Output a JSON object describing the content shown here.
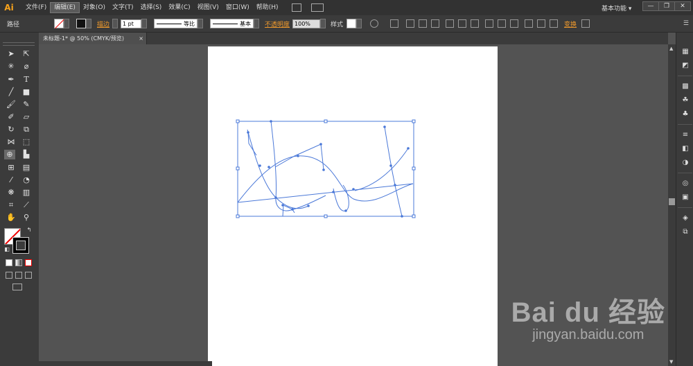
{
  "app": {
    "logo": "Ai"
  },
  "menu": {
    "items": [
      "文件(F)",
      "编辑(E)",
      "对象(O)",
      "文字(T)",
      "选择(S)",
      "效果(C)",
      "视图(V)",
      "窗口(W)",
      "帮助(H)"
    ],
    "active_index": 1
  },
  "workspace": {
    "label": "基本功能",
    "dropdown": "▾"
  },
  "window_buttons": {
    "minimize": "—",
    "restore": "❐",
    "close": "✕"
  },
  "control": {
    "selection_label": "路径",
    "stroke_label": "描边",
    "stroke_weight": "1 pt",
    "profile_label": "等比",
    "brush_label": "基本",
    "opacity_label": "不透明度",
    "opacity_value": "100%",
    "style_label": "样式",
    "transform_label": "变换"
  },
  "document": {
    "tab_title": "未标题-1* @ 50% (CMYK/预览)",
    "close": "×"
  },
  "colors": {
    "accent_orange": "#f09a2c",
    "path_blue": "#4a78d8",
    "ui_dark": "#323232",
    "ui_panel": "#3b3b3b",
    "canvas_gray": "#535353"
  },
  "tools": {
    "icons": [
      "selection-tool",
      "direct-selection-tool",
      "magic-wand-tool",
      "lasso-tool",
      "pen-tool",
      "type-tool",
      "line-tool",
      "rectangle-tool",
      "paintbrush-tool",
      "pencil-tool",
      "blob-brush-tool",
      "eraser-tool",
      "rotate-tool",
      "scale-tool",
      "width-tool",
      "free-transform-tool",
      "shape-builder-tool",
      "perspective-grid-tool",
      "mesh-tool",
      "gradient-tool",
      "eyedropper-tool",
      "blend-tool",
      "symbol-sprayer-tool",
      "graph-tool",
      "artboard-tool",
      "slice-tool",
      "hand-tool",
      "zoom-tool"
    ]
  },
  "watermark": {
    "brand": "Bai du 经验",
    "url": "jingyan.baidu.com"
  }
}
